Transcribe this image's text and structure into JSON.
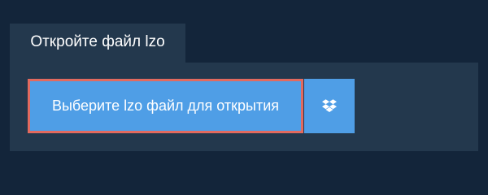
{
  "tab": {
    "label": "Откройте файл lzo"
  },
  "upload": {
    "choose_label": "Выберите lzo файл для открытия",
    "dropbox_icon": "dropbox-icon"
  },
  "colors": {
    "background": "#13253a",
    "panel": "#23384d",
    "button": "#4f9ee6",
    "highlight_border": "#e26a5f",
    "text": "#ffffff"
  }
}
